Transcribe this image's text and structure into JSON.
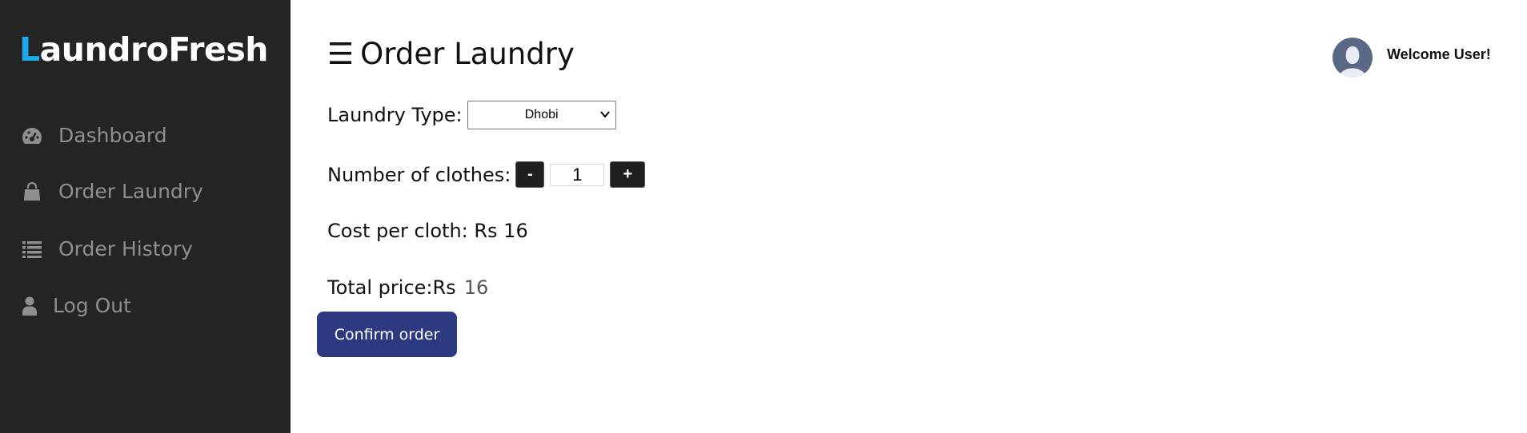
{
  "brand": {
    "first_letter": "L",
    "rest": "aundroFresh"
  },
  "sidebar": {
    "items": [
      {
        "label": "Dashboard",
        "icon": "dashboard-gauge-icon"
      },
      {
        "label": "Order Laundry",
        "icon": "shopping-bag-icon"
      },
      {
        "label": "Order History",
        "icon": "list-icon"
      },
      {
        "label": "Log Out",
        "icon": "user-icon"
      }
    ]
  },
  "header": {
    "menu_icon": "☰",
    "title": "Order Laundry",
    "welcome": "Welcome User!"
  },
  "form": {
    "laundry_type_label": "Laundry Type:",
    "laundry_type_value": "Dhobi",
    "clothes_label": "Number of clothes:",
    "decrement_label": "-",
    "increment_label": "+",
    "quantity": "1",
    "cost_label": "Cost per cloth: Rs 16",
    "total_label": "Total price:Rs",
    "total_value": "16",
    "confirm_label": "Confirm order"
  },
  "colors": {
    "sidebar_bg": "#242424",
    "brand_accent": "#1fa8ea",
    "confirm_bg": "#2d3a81"
  }
}
